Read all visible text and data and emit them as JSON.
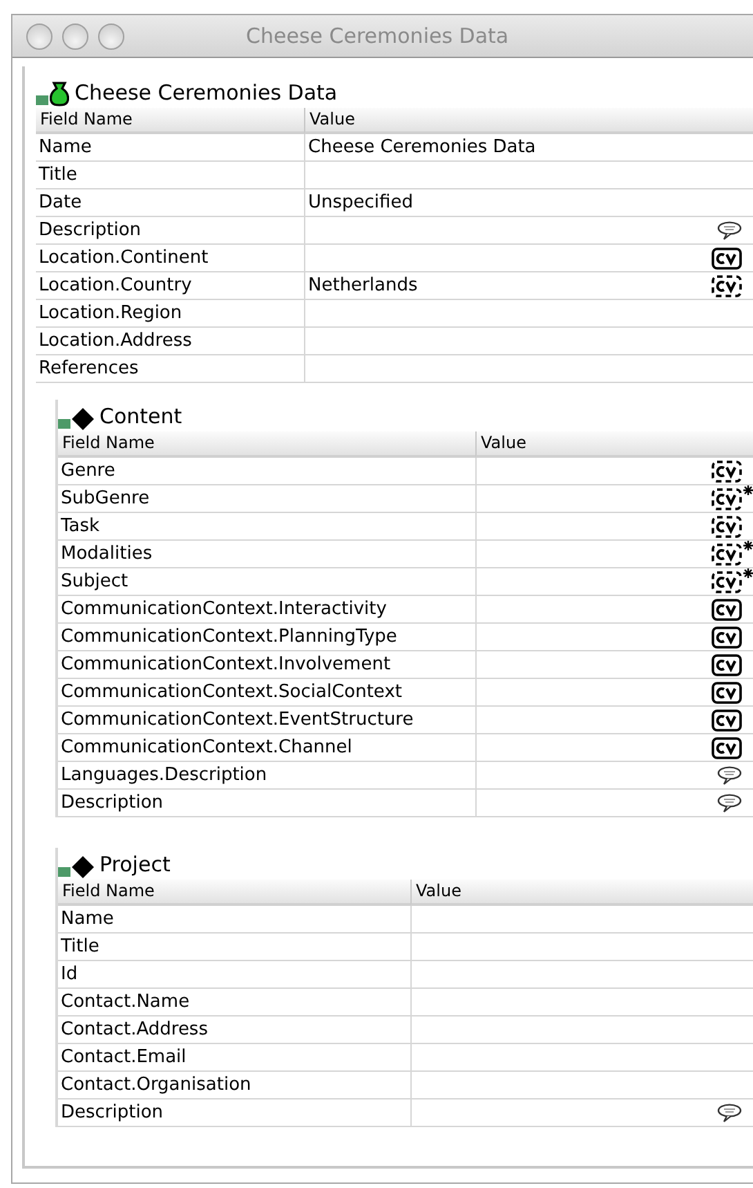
{
  "window": {
    "title": "Cheese Ceremonies Data"
  },
  "section": {
    "title": "Cheese Ceremonies Data",
    "kind": "bag",
    "columns": [
      "Field Name",
      "Value"
    ],
    "rows": [
      {
        "name": "Name",
        "value": "Cheese Ceremonies Data"
      },
      {
        "name": "Title"
      },
      {
        "name": "Date",
        "value": "Unspecified"
      },
      {
        "name": "Description",
        "kind": "note"
      },
      {
        "name": "Location.Continent",
        "kind": "cv"
      },
      {
        "name": "Location.Country",
        "value": "Netherlands",
        "kind": "cvopen"
      },
      {
        "name": "Location.Region"
      },
      {
        "name": "Location.Address"
      },
      {
        "name": "References"
      }
    ],
    "children": [
      {
        "title": "Content",
        "kind": "diamond",
        "columns": [
          "Field Name",
          "Value"
        ],
        "rows": [
          {
            "name": "Genre",
            "kind": "cvopen",
            "multiple": false
          },
          {
            "name": "SubGenre",
            "kind": "cvopen",
            "multiple": true
          },
          {
            "name": "Task",
            "kind": "cvopen",
            "multiple": false
          },
          {
            "name": "Modalities",
            "kind": "cvopen",
            "multiple": true
          },
          {
            "name": "Subject",
            "kind": "cvopen",
            "multiple": true
          },
          {
            "name": "CommunicationContext.Interactivity",
            "kind": "cv"
          },
          {
            "name": "CommunicationContext.PlanningType",
            "kind": "cv"
          },
          {
            "name": "CommunicationContext.Involvement",
            "kind": "cv"
          },
          {
            "name": "CommunicationContext.SocialContext",
            "kind": "cv"
          },
          {
            "name": "CommunicationContext.EventStructure",
            "kind": "cv"
          },
          {
            "name": "CommunicationContext.Channel",
            "kind": "cv"
          },
          {
            "name": "Languages.Description",
            "kind": "note"
          },
          {
            "name": "Description",
            "kind": "note"
          }
        ]
      },
      {
        "title": "Project",
        "kind": "diamond",
        "columns": [
          "Field Name",
          "Value"
        ],
        "rows": [
          {
            "name": "Name"
          },
          {
            "name": "Title"
          },
          {
            "name": "Id"
          },
          {
            "name": "Contact.Name"
          },
          {
            "name": "Contact.Address"
          },
          {
            "name": "Contact.Email"
          },
          {
            "name": "Contact.Organisation"
          },
          {
            "name": "Description",
            "kind": "note"
          }
        ]
      }
    ]
  }
}
